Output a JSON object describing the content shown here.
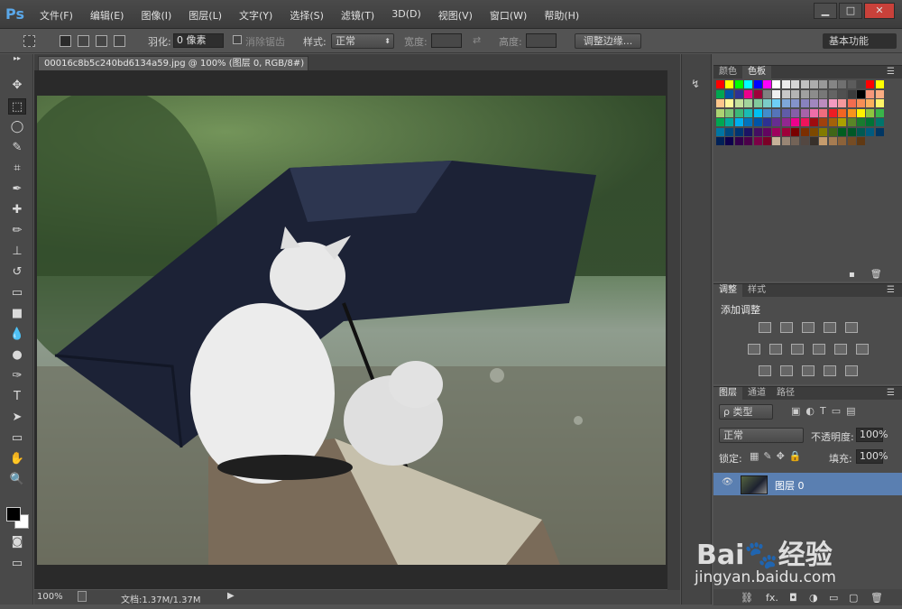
{
  "app": {
    "logo": "Ps"
  },
  "menu": [
    "文件(F)",
    "编辑(E)",
    "图像(I)",
    "图层(L)",
    "文字(Y)",
    "选择(S)",
    "滤镜(T)",
    "3D(D)",
    "视图(V)",
    "窗口(W)",
    "帮助(H)"
  ],
  "window_controls": {
    "minimize": "▁",
    "maximize": "□",
    "close": "✕"
  },
  "options": {
    "feather_label": "羽化:",
    "feather_value": "0 像素",
    "antialias_label": "消除锯齿",
    "style_label": "样式:",
    "style_value": "正常",
    "width_label": "宽度:",
    "height_label": "高度:",
    "refine_edge": "调整边缘...",
    "workspace": "基本功能"
  },
  "document": {
    "tab_title": "00016c8b5c240bd6134a59.jpg @ 100% (图层 0, RGB/8#) *",
    "tab_close": "×"
  },
  "status": {
    "zoom": "100%",
    "doc_info": "文档:1.37M/1.37M"
  },
  "tools": [
    "move-tool",
    "marquee-tool",
    "lasso-tool",
    "quick-select-tool",
    "crop-tool",
    "eyedropper-tool",
    "healing-tool",
    "brush-tool",
    "stamp-tool",
    "history-brush-tool",
    "eraser-tool",
    "gradient-tool",
    "blur-tool",
    "dodge-tool",
    "pen-tool",
    "type-tool",
    "path-select-tool",
    "shape-tool",
    "hand-tool",
    "zoom-tool"
  ],
  "tool_glyphs": [
    "✥",
    "⬚",
    "◯",
    "✎",
    "⌗",
    "✒",
    "✚",
    "✏",
    "⊥",
    "↺",
    "▭",
    "■",
    "💧",
    "●",
    "✑",
    "T",
    "➤",
    "▭",
    "✋",
    "🔍"
  ],
  "panels": {
    "color_tabs": [
      "颜色",
      "色板"
    ],
    "swatches": [
      "#ff0000",
      "#ffff00",
      "#00ff00",
      "#00ffff",
      "#0000ff",
      "#ff00ff",
      "#ffffff",
      "#ebebeb",
      "#d6d6d6",
      "#c2c2c2",
      "#adadad",
      "#999999",
      "#858585",
      "#707070",
      "#5c5c5c",
      "#474747",
      "#ff0000",
      "#ffff00",
      "#00a651",
      "#0054a6",
      "#2e3192",
      "#ec008c",
      "#9e0039",
      "#808080",
      "#f0f0f0",
      "#c8c8c8",
      "#b4b4b4",
      "#a0a0a0",
      "#8c8c8c",
      "#787878",
      "#646464",
      "#505050",
      "#3c3c3c",
      "#000000",
      "#f7977a",
      "#fbad82",
      "#fdc68c",
      "#fff799",
      "#c4df9b",
      "#a3d39c",
      "#82ca9c",
      "#7bcdc8",
      "#6ecff6",
      "#7ea7d8",
      "#8493ca",
      "#8882be",
      "#a187be",
      "#bc8cbf",
      "#f49ac1",
      "#f5989d",
      "#f26c4f",
      "#f68e55",
      "#fbaf5c",
      "#fff467",
      "#acd372",
      "#7cc576",
      "#3bb878",
      "#1abbb4",
      "#00bff3",
      "#438ccb",
      "#5574b9",
      "#605ca8",
      "#855fa8",
      "#a763a9",
      "#ef6ea8",
      "#f16d7e",
      "#ed1c24",
      "#f26522",
      "#f7941d",
      "#fff200",
      "#8dc63f",
      "#39b54a",
      "#00a651",
      "#00a99d",
      "#00aeef",
      "#0072bc",
      "#0054a6",
      "#2e3192",
      "#662d91",
      "#92278f",
      "#ec008c",
      "#ed145b",
      "#9e0b0f",
      "#a0410d",
      "#a3620a",
      "#aba000",
      "#598527",
      "#197b30",
      "#007236",
      "#00746b",
      "#0076a3",
      "#004a80",
      "#003471",
      "#1b1464",
      "#440e62",
      "#630460",
      "#9e005d",
      "#9e0039",
      "#790000",
      "#7b2e00",
      "#7d4900",
      "#827b00",
      "#406618",
      "#005e20",
      "#005826",
      "#005952",
      "#005b7f",
      "#003663",
      "#002157",
      "#0d004c",
      "#32004b",
      "#4b0049",
      "#7b0046",
      "#7a0026",
      "#c7b299",
      "#998675",
      "#736357",
      "#534741",
      "#37302a",
      "#c69c6d",
      "#a67c52",
      "#8c6239",
      "#754c24",
      "#603913"
    ],
    "adjust_tabs": [
      "调整",
      "样式"
    ],
    "add_adjustment": "添加调整",
    "layers_tabs": [
      "图层",
      "通道",
      "路径"
    ],
    "kind_filter": "ρ 类型",
    "blend_mode": "正常",
    "opacity_label": "不透明度:",
    "opacity_value": "100%",
    "lock_label": "锁定:",
    "fill_label": "填充:",
    "fill_value": "100%",
    "layer_name": "图层 0",
    "layer_footer": [
      "⛓",
      "fx.",
      "◘",
      "◑",
      "▭",
      "▢",
      "🗑"
    ]
  },
  "watermark": {
    "brand": "Bai🐾经验",
    "url": "jingyan.baidu.com"
  },
  "colors": {
    "bg": "#535353",
    "panel": "#4c4c4c",
    "accent": "#5a7fb1",
    "canvas": "#2a2a2a"
  }
}
